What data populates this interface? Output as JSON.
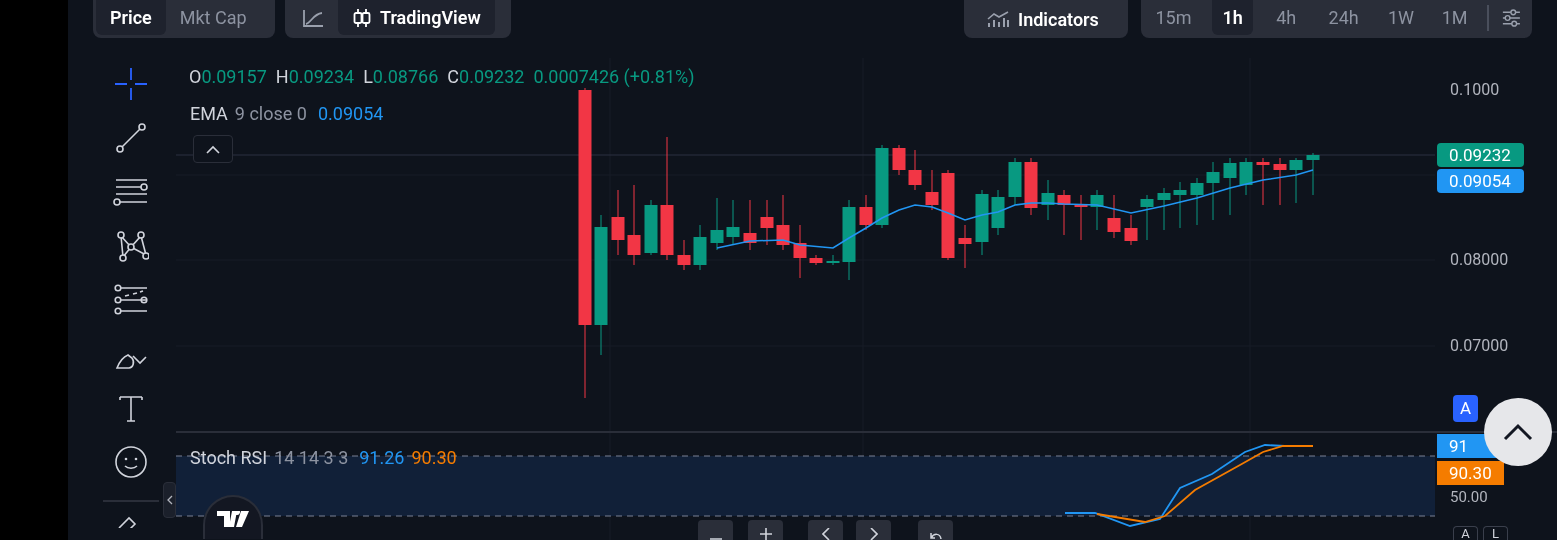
{
  "value_toggle": [
    {
      "label": "Price",
      "selected": true
    },
    {
      "label": "Mkt Cap",
      "selected": false
    }
  ],
  "chart_type": [
    {
      "kind": "line",
      "selected": false
    },
    {
      "kind": "candles",
      "label": "TradingView",
      "selected": true
    }
  ],
  "indicators_button": {
    "label": "Indicators"
  },
  "timeframes": [
    {
      "label": "15m",
      "selected": false
    },
    {
      "label": "1h",
      "selected": true
    },
    {
      "label": "4h",
      "selected": false
    },
    {
      "label": "24h",
      "selected": false
    },
    {
      "label": "1W",
      "selected": false
    },
    {
      "label": "1M",
      "selected": false
    }
  ],
  "legend": {
    "ohlc": [
      {
        "label": "O",
        "value": "0.09157"
      },
      {
        "label": "H",
        "value": "0.09234"
      },
      {
        "label": "L",
        "value": "0.08766"
      },
      {
        "label": "C",
        "value": "0.09232"
      }
    ],
    "change": "0.0007426 (+0.81%)",
    "ema": {
      "name": "EMA",
      "params": "9 close 0",
      "value": "0.09054"
    }
  },
  "price_axis": [
    "0.1000",
    "0.08000",
    "0.07000"
  ],
  "price_tags": [
    {
      "text": "0.09232",
      "color": "#089981"
    },
    {
      "text": "0.09054",
      "color": "#2196f3"
    }
  ],
  "scale_buttons": [
    {
      "label": "A",
      "selected": true
    }
  ],
  "stoch_rsi": {
    "name": "Stoch RSI",
    "params": "14 14 3 3",
    "k": "91.26",
    "d": "90.30",
    "tags": [
      {
        "text": "91",
        "color": "#2196f3"
      },
      {
        "text": "90.30",
        "color": "#f57c00"
      }
    ],
    "axis_label": "50.00"
  },
  "bottom_scale_buttons": [
    {
      "label": "A"
    },
    {
      "label": "L"
    }
  ]
}
